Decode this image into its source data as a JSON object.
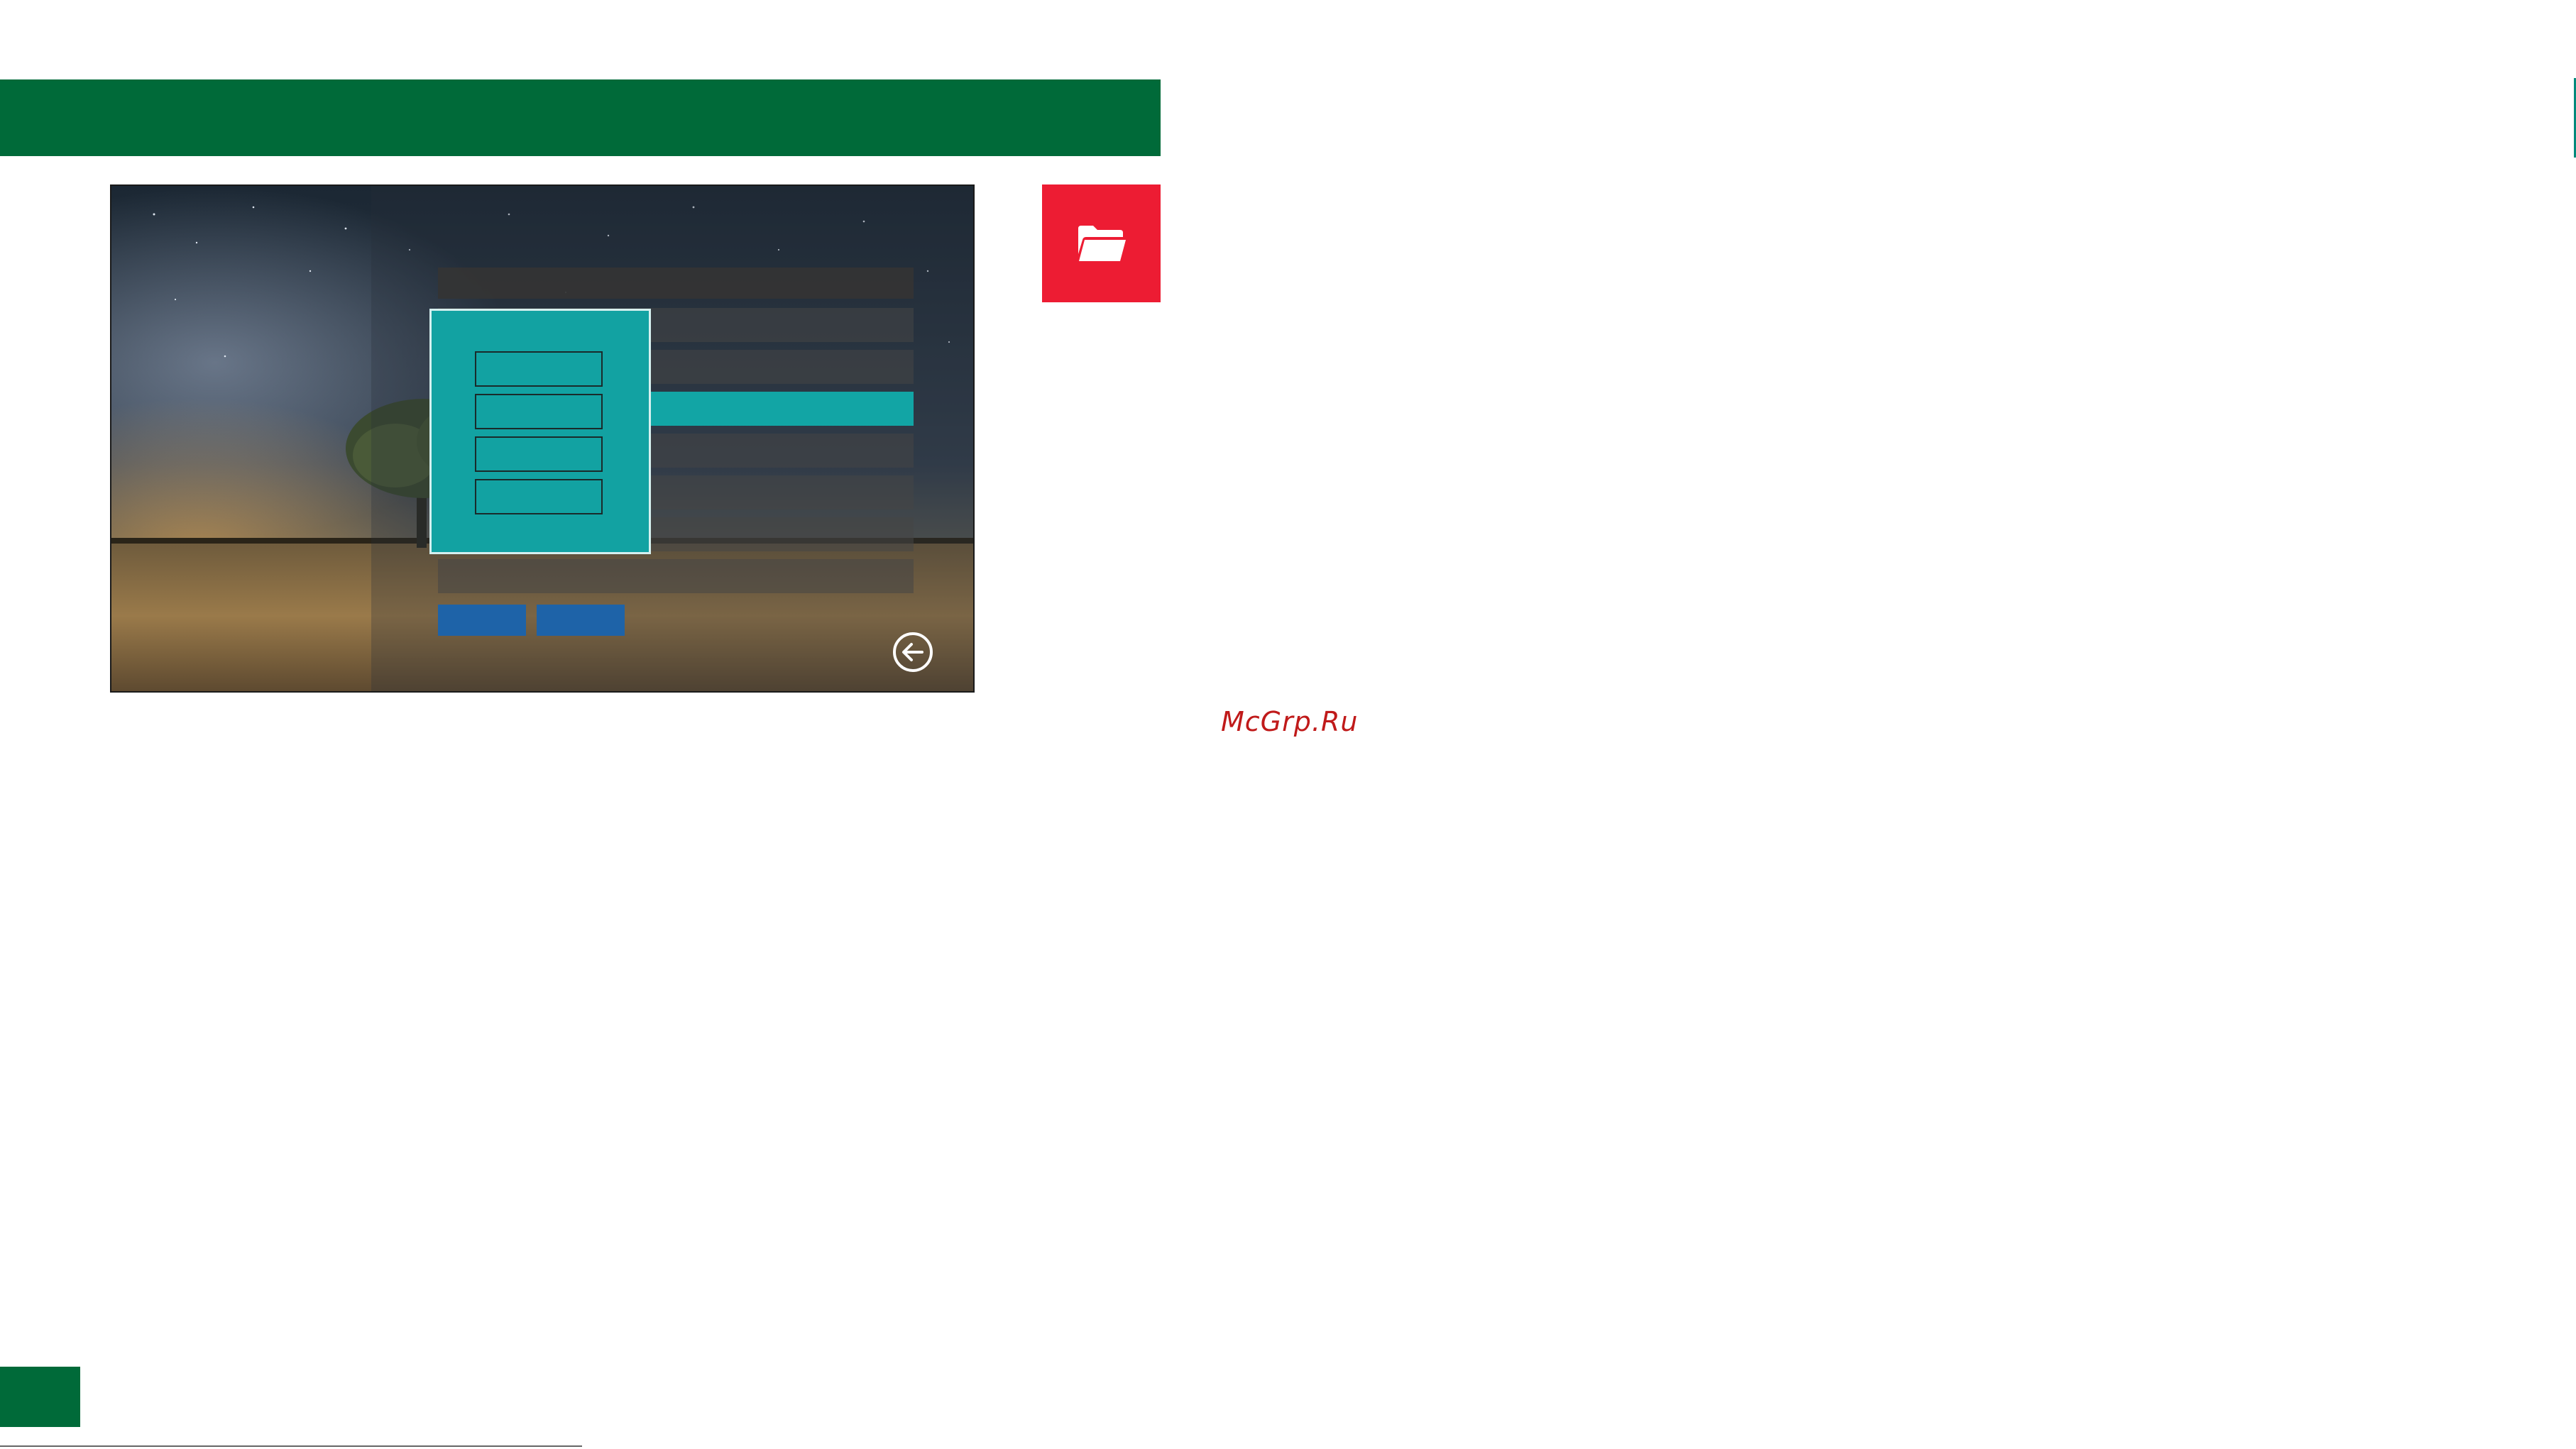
{
  "watermark": {
    "text": "McGrp.Ru"
  },
  "colors": {
    "header_green": "#006a39",
    "folder_red": "#ed1c33",
    "menu_teal": "#12a5a5",
    "button_blue": "#1e63a8",
    "watermark_red": "#c01a1a"
  },
  "icons": {
    "folder": "open-folder-icon",
    "back": "arrow-left-circle-icon"
  }
}
